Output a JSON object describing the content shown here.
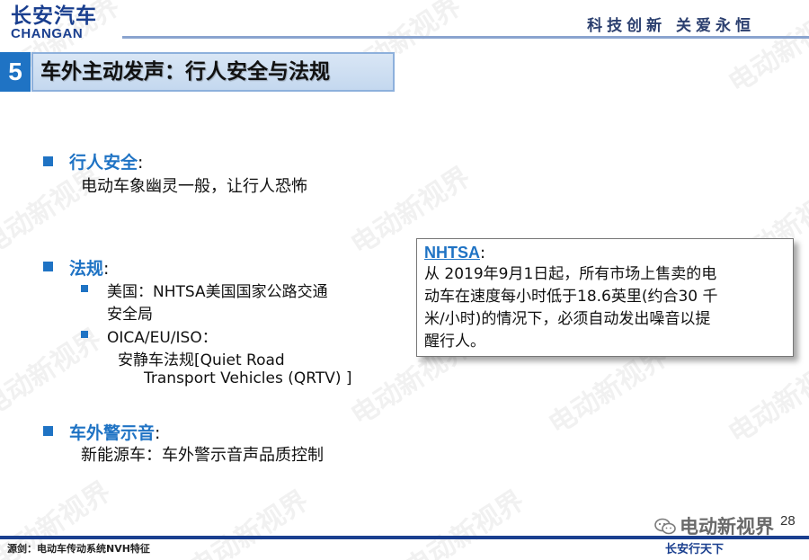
{
  "header": {
    "logo_cn": "长安汽车",
    "logo_en": "CHANGAN",
    "slogan": "科技创新 关爱永恒"
  },
  "section": {
    "number": "5",
    "title": "车外主动发声：行人安全与法规"
  },
  "content": {
    "pedestrian": {
      "heading": "行人安全",
      "colon": ":",
      "text": "电动车象幽灵一般，让行人恐怖"
    },
    "regulation": {
      "heading": "法规",
      "colon": ":",
      "items": [
        {
          "line1": "美国：NHTSA美国国家公路交通",
          "line2": "安全局"
        },
        {
          "line1": "OICA/EU/ISO：",
          "line2": "安静车法规[Quiet Road",
          "line3": "Transport Vehicles (QRTV) ]"
        }
      ]
    },
    "warning": {
      "heading": "车外警示音",
      "colon": ":",
      "text": "新能源车：车外警示音声品质控制"
    }
  },
  "nhtsa_box": {
    "title": "NHTSA",
    "colon": ":",
    "lines": [
      "从 2019年9月1日起，所有市场上售卖的电",
      "动车在速度每小时低于18.6英里(约合30 千",
      "米/小时)的情况下，必须自动发出噪音以提",
      "醒行人。"
    ]
  },
  "footer": {
    "source": "源剑：电动车传动系统NVH特征",
    "page": "28",
    "wechat_name": "电动新视界",
    "corner_logo": "长安行天下"
  },
  "watermark_text": "电动新视界",
  "colors": {
    "brand_blue": "#1a3f8f",
    "accent_blue": "#1f73c4",
    "title_bg": "#c4d8ef"
  }
}
